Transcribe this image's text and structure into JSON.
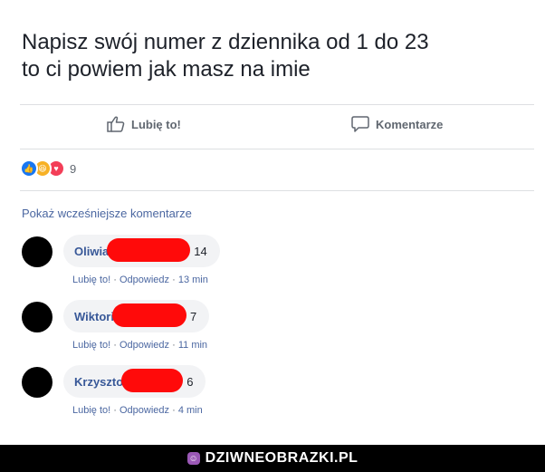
{
  "post": {
    "text_line1": "Napisz swój numer z dziennika od 1 do 23",
    "text_line2": "to ci powiem jak masz na imie"
  },
  "actions": {
    "like_label": "Lubię to!",
    "like_icon": "thumbs-up-icon",
    "comment_label": "Komentarze",
    "comment_icon": "speech-bubble-icon"
  },
  "reactions": {
    "icons": [
      "like-reaction-icon",
      "haha-reaction-icon",
      "love-reaction-icon"
    ],
    "count": "9",
    "colors": {
      "like": "#1877f2",
      "haha": "#f7b125",
      "love": "#f33e58"
    }
  },
  "previous_comments_label": "Pokaż wcześniejsze komentarze",
  "comments": [
    {
      "author": "Oliwia",
      "text": "14",
      "like": "Lubię to!",
      "reply": "Odpowiedz",
      "time": "13 min"
    },
    {
      "author": "Wiktori",
      "text": "7",
      "like": "Lubię to!",
      "reply": "Odpowiedz",
      "time": "11 min"
    },
    {
      "author": "Krzyszto",
      "text": "6",
      "like": "Lubię to!",
      "reply": "Odpowiedz",
      "time": "4 min"
    }
  ],
  "meta_separator": "·",
  "footer": {
    "brand": "DZIWNEOBRAZKI.PL"
  },
  "colors": {
    "link": "#385898",
    "redaction": "#ff0a0a",
    "footer_bg": "#000000"
  }
}
